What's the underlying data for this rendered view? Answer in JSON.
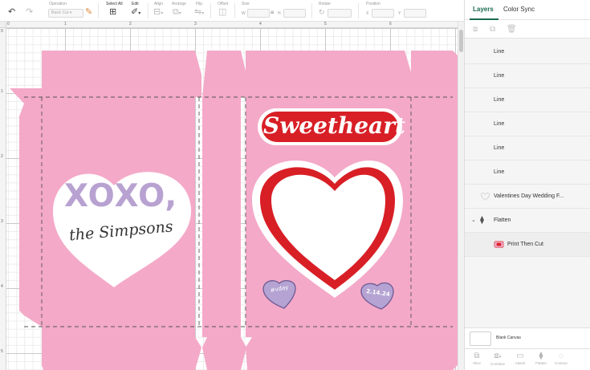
{
  "toolbar": {
    "operation_label": "Operation",
    "operation_value": "Basic Cut",
    "select_all_label": "Select All",
    "edit_label": "Edit",
    "align_label": "Align",
    "arrange_label": "Arrange",
    "flip_label": "Flip",
    "offset_label": "Offset",
    "size_label": "Size",
    "size_w": "W",
    "size_h": "H",
    "rotate_label": "Rotate",
    "position_label": "Position",
    "position_x": "X",
    "position_y": "Y"
  },
  "ruler": {
    "top": [
      "0",
      "1",
      "2",
      "3",
      "4",
      "5",
      "6"
    ],
    "left": [
      "0",
      "1",
      "2",
      "3",
      "4",
      "5"
    ]
  },
  "design": {
    "left_heart_line1": "XOXO,",
    "left_heart_line2": "the Simpsons",
    "title": "Sweetheart",
    "candy_left": "#vday",
    "candy_right": "2.14.24",
    "colors": {
      "box_pink": "#f4a9c8",
      "heart_red": "#d81f26",
      "text_lavender": "#b8a2d1",
      "candy_lavender": "#b5a3d3"
    }
  },
  "panel": {
    "tabs": [
      "Layers",
      "Color Sync"
    ],
    "layers": [
      {
        "label": "Line",
        "icon": "none"
      },
      {
        "label": "Line",
        "icon": "none"
      },
      {
        "label": "Line",
        "icon": "none"
      },
      {
        "label": "Line",
        "icon": "none"
      },
      {
        "label": "Line",
        "icon": "none"
      },
      {
        "label": "Line",
        "icon": "none"
      },
      {
        "label": "Valentines Day Wedding F...",
        "icon": "heart-outline-icon"
      },
      {
        "label": "Flatten",
        "icon": "layers-icon"
      },
      {
        "label": "Print Then Cut",
        "icon": "print-then-cut-icon"
      }
    ],
    "blank_canvas": "Blank Canvas",
    "bottom_actions": [
      "Slice",
      "Combine",
      "Attach",
      "Flatten",
      "Contour"
    ]
  }
}
